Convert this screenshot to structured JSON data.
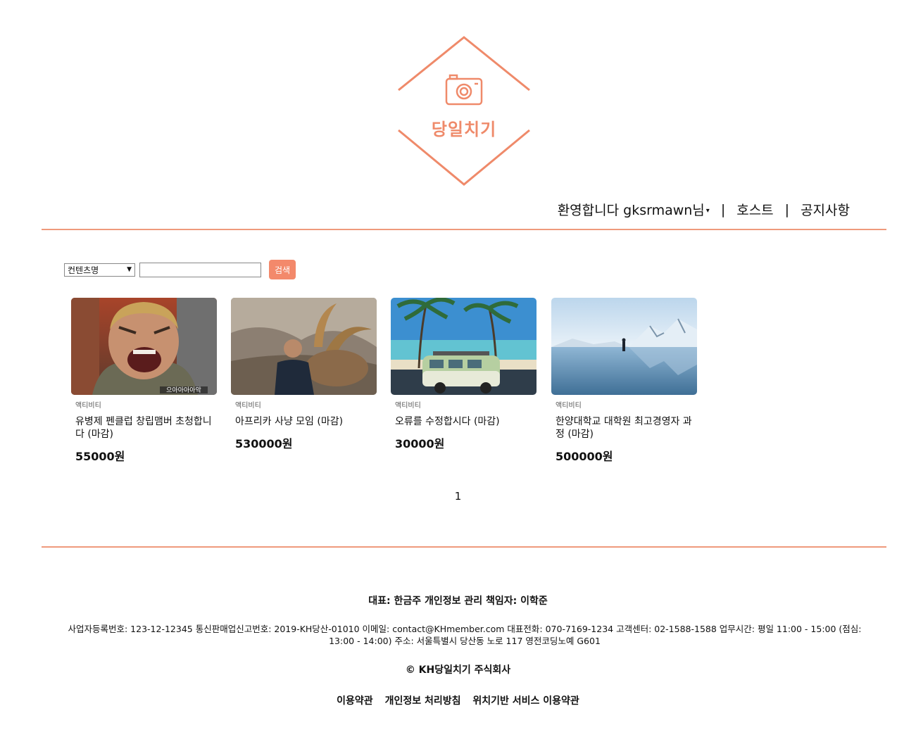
{
  "brand": {
    "name": "당일치기",
    "color": "#ef8a6a"
  },
  "nav": {
    "welcome": "환영합니다 gksrmawn님",
    "host": "호스트",
    "notice": "공지사항",
    "separator": "|"
  },
  "search": {
    "selected_option": "컨텐츠명",
    "query": "",
    "button_label": "검색"
  },
  "products": [
    {
      "category": "액티비티",
      "title": "유병제 펜클럽 창립맴버 초청합니다 (마감)",
      "price": "55000원",
      "image": "man-shouting-photo",
      "caption": "으아아아아악"
    },
    {
      "category": "액티비티",
      "title": "아프리카 사냥 모임 (마감)",
      "price": "530000원",
      "image": "hunter-with-ibex-photo"
    },
    {
      "category": "액티비티",
      "title": "오류를 수정합시다 (마감)",
      "price": "30000원",
      "image": "van-under-palm-trees-photo"
    },
    {
      "category": "액티비티",
      "title": "한양대학교 대학원 최고경영자 과정 (마감)",
      "price": "500000원",
      "image": "frozen-lake-photo"
    }
  ],
  "pagination": {
    "current": "1"
  },
  "footer": {
    "line1": "대표: 한금주 개인정보 관리 책임자: 이학준",
    "line2": "사업자등록번호: 123-12-12345 통신판매업신고번호: 2019-KH당산-01010 이메일: contact@KHmember.com 대표전화: 070-7169-1234 고객센터: 02-1588-1588 업무시간: 평일 11:00 - 15:00 (점심: 13:00 - 14:00) 주소: 서울특별시 당산동 노로 117 영전코딩노예 G601",
    "copyright": "© KH당일치기 주식회사",
    "links": [
      "이용약관",
      "개인정보 처리방침",
      "위치기반 서비스 이용약관"
    ]
  }
}
